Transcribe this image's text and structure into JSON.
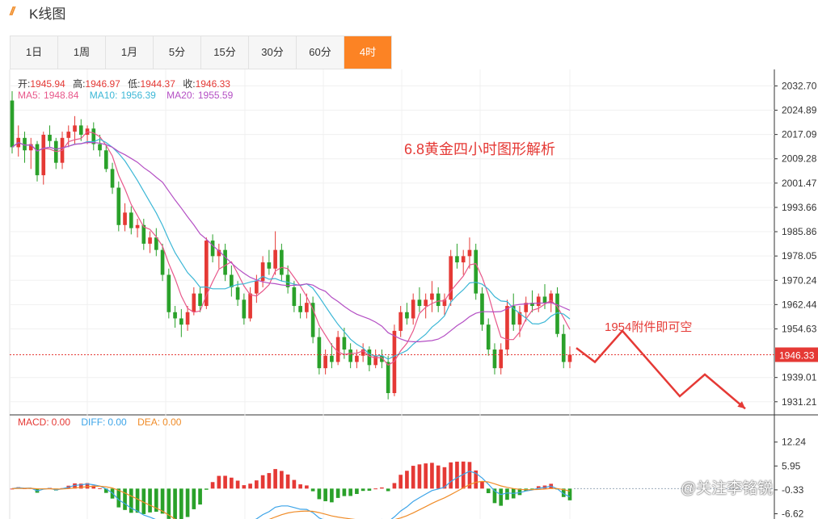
{
  "header": {
    "logo": "//",
    "title": "K线图"
  },
  "tabs": [
    {
      "label": "1日"
    },
    {
      "label": "1周"
    },
    {
      "label": "1月"
    },
    {
      "label": "5分"
    },
    {
      "label": "15分"
    },
    {
      "label": "30分"
    },
    {
      "label": "60分"
    },
    {
      "label": "4时"
    }
  ],
  "active_tab": "4时",
  "ohlc": {
    "open_label": "开:",
    "open": "1945.94",
    "high_label": "高:",
    "high": "1946.97",
    "low_label": "低:",
    "low": "1944.37",
    "close_label": "收:",
    "close": "1946.33"
  },
  "ma": {
    "ma5_label": "MA5:",
    "ma5": "1948.84",
    "ma10_label": "MA10:",
    "ma10": "1956.39",
    "ma20_label": "MA20:",
    "ma20": "1955.59"
  },
  "macd": {
    "macd_label": "MACD:",
    "macd": "0.00",
    "diff_label": "DIFF:",
    "diff": "0.00",
    "dea_label": "DEA:",
    "dea": "0.00"
  },
  "annotation": "6.8黄金四小时图形解析",
  "annotation2": "1954附件即可空",
  "current_price": "1946.33",
  "watermark": "@关注李铭锐",
  "colors": {
    "up": "#e53935",
    "down": "#2aa12a",
    "ma5": "#e8578a",
    "ma10": "#3cb7d6",
    "ma20": "#b44fc4",
    "diff": "#3ca4e8",
    "dea": "#f08c28",
    "accent": "#fc8324"
  },
  "chart_data": [
    {
      "type": "candlestick",
      "title": "",
      "ylim": [
        1927,
        2038
      ],
      "y_ticks": [
        "2032.70",
        "2024.89",
        "2017.09",
        "2009.28",
        "2001.47",
        "1993.66",
        "1985.86",
        "1978.05",
        "1970.24",
        "1962.44",
        "1954.63",
        "1946.33",
        "1939.01",
        "1931.21"
      ],
      "reference_line": 1946.33,
      "ohlc": [
        [
          2028,
          2031,
          2011,
          2013
        ],
        [
          2013,
          2020,
          2010,
          2016
        ],
        [
          2016,
          2018,
          2008,
          2012
        ],
        [
          2012,
          2016,
          2006,
          2014
        ],
        [
          2014,
          2015,
          2002,
          2004
        ],
        [
          2004,
          2018,
          2001,
          2017
        ],
        [
          2017,
          2020,
          2013,
          2015
        ],
        [
          2015,
          2016,
          2006,
          2008
        ],
        [
          2008,
          2018,
          2006,
          2016
        ],
        [
          2016,
          2020,
          2013,
          2018
        ],
        [
          2018,
          2023,
          2014,
          2020
        ],
        [
          2020,
          2022,
          2015,
          2017
        ],
        [
          2017,
          2020,
          2014,
          2019
        ],
        [
          2019,
          2021,
          2012,
          2014
        ],
        [
          2014,
          2017,
          2010,
          2012
        ],
        [
          2012,
          2014,
          2005,
          2006
        ],
        [
          2006,
          2008,
          1998,
          2000
        ],
        [
          2000,
          2002,
          1986,
          1988
        ],
        [
          1988,
          1995,
          1986,
          1992
        ],
        [
          1992,
          1994,
          1985,
          1987
        ],
        [
          1987,
          1990,
          1984,
          1988
        ],
        [
          1988,
          1990,
          1980,
          1982
        ],
        [
          1982,
          1986,
          1979,
          1984
        ],
        [
          1984,
          1987,
          1978,
          1980
        ],
        [
          1980,
          1982,
          1970,
          1972
        ],
        [
          1972,
          1974,
          1958,
          1960
        ],
        [
          1960,
          1962,
          1955,
          1958
        ],
        [
          1958,
          1961,
          1952,
          1956
        ],
        [
          1956,
          1962,
          1954,
          1960
        ],
        [
          1960,
          1968,
          1959,
          1966
        ],
        [
          1966,
          1968,
          1960,
          1962
        ],
        [
          1962,
          1984,
          1961,
          1983
        ],
        [
          1983,
          1985,
          1976,
          1978
        ],
        [
          1978,
          1982,
          1974,
          1980
        ],
        [
          1980,
          1982,
          1970,
          1972
        ],
        [
          1972,
          1975,
          1965,
          1968
        ],
        [
          1968,
          1970,
          1962,
          1964
        ],
        [
          1964,
          1966,
          1956,
          1958
        ],
        [
          1958,
          1968,
          1957,
          1966
        ],
        [
          1966,
          1972,
          1963,
          1970
        ],
        [
          1970,
          1978,
          1968,
          1976
        ],
        [
          1976,
          1980,
          1972,
          1974
        ],
        [
          1974,
          1986,
          1972,
          1980
        ],
        [
          1980,
          1982,
          1970,
          1972
        ],
        [
          1972,
          1975,
          1966,
          1968
        ],
        [
          1968,
          1970,
          1960,
          1962
        ],
        [
          1962,
          1966,
          1958,
          1960
        ],
        [
          1960,
          1966,
          1958,
          1963
        ],
        [
          1963,
          1965,
          1950,
          1952
        ],
        [
          1952,
          1955,
          1940,
          1942
        ],
        [
          1942,
          1948,
          1940,
          1946
        ],
        [
          1946,
          1950,
          1942,
          1944
        ],
        [
          1944,
          1954,
          1943,
          1952
        ],
        [
          1952,
          1955,
          1945,
          1948
        ],
        [
          1948,
          1950,
          1942,
          1944
        ],
        [
          1944,
          1948,
          1942,
          1946
        ],
        [
          1946,
          1950,
          1944,
          1948
        ],
        [
          1948,
          1949,
          1941,
          1943
        ],
        [
          1943,
          1948,
          1942,
          1946
        ],
        [
          1946,
          1948,
          1942,
          1944
        ],
        [
          1944,
          1946,
          1932,
          1934
        ],
        [
          1934,
          1956,
          1933,
          1954
        ],
        [
          1954,
          1962,
          1952,
          1960
        ],
        [
          1960,
          1963,
          1956,
          1958
        ],
        [
          1958,
          1966,
          1956,
          1964
        ],
        [
          1964,
          1968,
          1960,
          1962
        ],
        [
          1962,
          1966,
          1958,
          1964
        ],
        [
          1964,
          1970,
          1960,
          1966
        ],
        [
          1966,
          1968,
          1960,
          1962
        ],
        [
          1962,
          1966,
          1959,
          1964
        ],
        [
          1964,
          1980,
          1962,
          1978
        ],
        [
          1978,
          1982,
          1974,
          1976
        ],
        [
          1976,
          1980,
          1972,
          1978
        ],
        [
          1978,
          1984,
          1974,
          1980
        ],
        [
          1980,
          1982,
          1964,
          1966
        ],
        [
          1966,
          1968,
          1954,
          1956
        ],
        [
          1956,
          1958,
          1946,
          1948
        ],
        [
          1948,
          1950,
          1940,
          1942
        ],
        [
          1942,
          1950,
          1940,
          1948
        ],
        [
          1948,
          1964,
          1946,
          1962
        ],
        [
          1962,
          1966,
          1954,
          1956
        ],
        [
          1956,
          1962,
          1952,
          1960
        ],
        [
          1960,
          1965,
          1957,
          1963
        ],
        [
          1963,
          1967,
          1960,
          1962
        ],
        [
          1962,
          1966,
          1960,
          1965
        ],
        [
          1965,
          1969,
          1961,
          1963
        ],
        [
          1963,
          1967,
          1960,
          1966
        ],
        [
          1966,
          1968,
          1952,
          1953
        ],
        [
          1953,
          1956,
          1942,
          1944
        ],
        [
          1944,
          1949,
          1942,
          1946.33
        ]
      ],
      "series": [
        {
          "name": "MA5"
        },
        {
          "name": "MA10"
        },
        {
          "name": "MA20"
        }
      ]
    },
    {
      "type": "macd",
      "title": "",
      "ylim": [
        -8,
        16
      ],
      "y_ticks": [
        "12.24",
        "5.95",
        "-0.33",
        "-6.62"
      ]
    }
  ]
}
